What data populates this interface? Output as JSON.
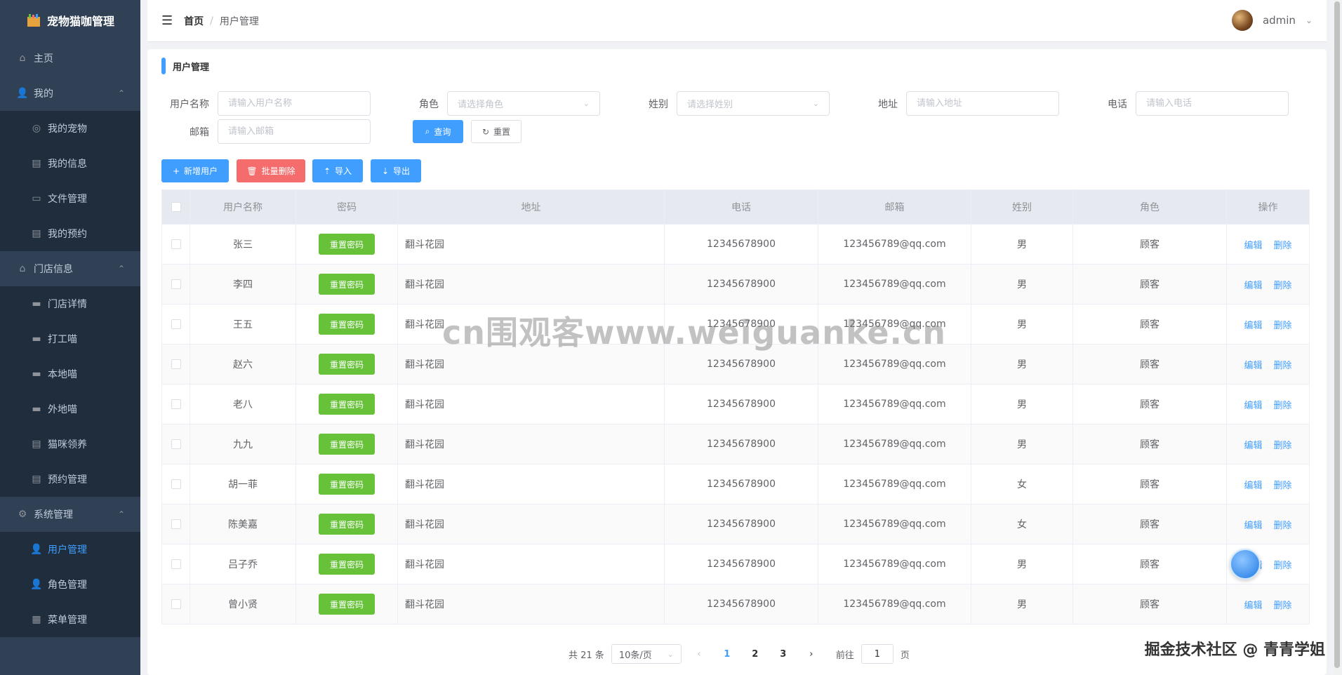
{
  "app": {
    "title": "宠物猫咖管理"
  },
  "sidebar": {
    "items": [
      {
        "label": "主页",
        "icon": "home-icon",
        "level": 0
      },
      {
        "label": "我的",
        "icon": "user-icon",
        "level": 0,
        "expanded": true
      },
      {
        "label": "我的宠物",
        "icon": "pet-icon",
        "level": 1
      },
      {
        "label": "我的信息",
        "icon": "doc-icon",
        "level": 1
      },
      {
        "label": "文件管理",
        "icon": "briefcase-icon",
        "level": 1
      },
      {
        "label": "我的预约",
        "icon": "doc-icon",
        "level": 1
      },
      {
        "label": "门店信息",
        "icon": "house-icon",
        "level": 0,
        "expanded": true
      },
      {
        "label": "门店详情",
        "icon": "monitor-icon",
        "level": 1
      },
      {
        "label": "打工喵",
        "icon": "monitor-icon",
        "level": 1
      },
      {
        "label": "本地喵",
        "icon": "monitor-icon",
        "level": 1
      },
      {
        "label": "外地喵",
        "icon": "monitor-icon",
        "level": 1
      },
      {
        "label": "猫咪领养",
        "icon": "doc-icon",
        "level": 1
      },
      {
        "label": "预约管理",
        "icon": "doc-icon",
        "level": 1
      },
      {
        "label": "系统管理",
        "icon": "gear-icon",
        "level": 0,
        "expanded": true
      },
      {
        "label": "用户管理",
        "icon": "user-icon",
        "level": 1,
        "active": true
      },
      {
        "label": "角色管理",
        "icon": "user-icon",
        "level": 1
      },
      {
        "label": "菜单管理",
        "icon": "grid-icon",
        "level": 1
      }
    ]
  },
  "header": {
    "breadcrumb": {
      "home": "首页",
      "separator": "/",
      "current": "用户管理"
    },
    "username": "admin"
  },
  "card": {
    "title": "用户管理"
  },
  "search": {
    "username": {
      "label": "用户名称",
      "placeholder": "请输入用户名称"
    },
    "role": {
      "label": "角色",
      "placeholder": "请选择角色"
    },
    "gender": {
      "label": "姓别",
      "placeholder": "请选择姓别"
    },
    "address": {
      "label": "地址",
      "placeholder": "请输入地址"
    },
    "phone": {
      "label": "电话",
      "placeholder": "请输入电话"
    },
    "email": {
      "label": "邮箱",
      "placeholder": "请输入邮箱"
    },
    "query_label": "查询",
    "reset_label": "重置"
  },
  "toolbar": {
    "add_label": "新增用户",
    "batch_delete_label": "批量删除",
    "import_label": "导入",
    "export_label": "导出"
  },
  "table": {
    "headers": [
      "用户名称",
      "密码",
      "地址",
      "电话",
      "邮箱",
      "姓别",
      "角色",
      "操作"
    ],
    "reset_pwd_label": "重置密码",
    "edit_label": "编辑",
    "delete_label": "删除",
    "rows": [
      {
        "name": "张三",
        "address": "翻斗花园",
        "phone": "12345678900",
        "email": "123456789@qq.com",
        "gender": "男",
        "role": "顾客"
      },
      {
        "name": "李四",
        "address": "翻斗花园",
        "phone": "12345678900",
        "email": "123456789@qq.com",
        "gender": "男",
        "role": "顾客"
      },
      {
        "name": "王五",
        "address": "翻斗花园",
        "phone": "12345678900",
        "email": "123456789@qq.com",
        "gender": "男",
        "role": "顾客"
      },
      {
        "name": "赵六",
        "address": "翻斗花园",
        "phone": "12345678900",
        "email": "123456789@qq.com",
        "gender": "男",
        "role": "顾客"
      },
      {
        "name": "老八",
        "address": "翻斗花园",
        "phone": "12345678900",
        "email": "123456789@qq.com",
        "gender": "男",
        "role": "顾客"
      },
      {
        "name": "九九",
        "address": "翻斗花园",
        "phone": "12345678900",
        "email": "123456789@qq.com",
        "gender": "男",
        "role": "顾客"
      },
      {
        "name": "胡一菲",
        "address": "翻斗花园",
        "phone": "12345678900",
        "email": "123456789@qq.com",
        "gender": "女",
        "role": "顾客"
      },
      {
        "name": "陈美嘉",
        "address": "翻斗花园",
        "phone": "12345678900",
        "email": "123456789@qq.com",
        "gender": "女",
        "role": "顾客"
      },
      {
        "name": "吕子乔",
        "address": "翻斗花园",
        "phone": "12345678900",
        "email": "123456789@qq.com",
        "gender": "男",
        "role": "顾客"
      },
      {
        "name": "曾小贤",
        "address": "翻斗花园",
        "phone": "12345678900",
        "email": "123456789@qq.com",
        "gender": "男",
        "role": "顾客"
      }
    ]
  },
  "pagination": {
    "total_label": "共 21 条",
    "page_size_label": "10条/页",
    "pages": [
      "1",
      "2",
      "3"
    ],
    "current_page": "1",
    "goto_prefix": "前往",
    "goto_value": "1",
    "goto_suffix": "页"
  },
  "overlay": {
    "watermark": "cn围观客www.weiguanke.cn",
    "corner_credit": "掘金技术社区 @ 青青学姐"
  },
  "colors": {
    "sidebar_bg": "#304156",
    "primary": "#409eff",
    "success": "#67c23a",
    "danger": "#f56c6c"
  }
}
